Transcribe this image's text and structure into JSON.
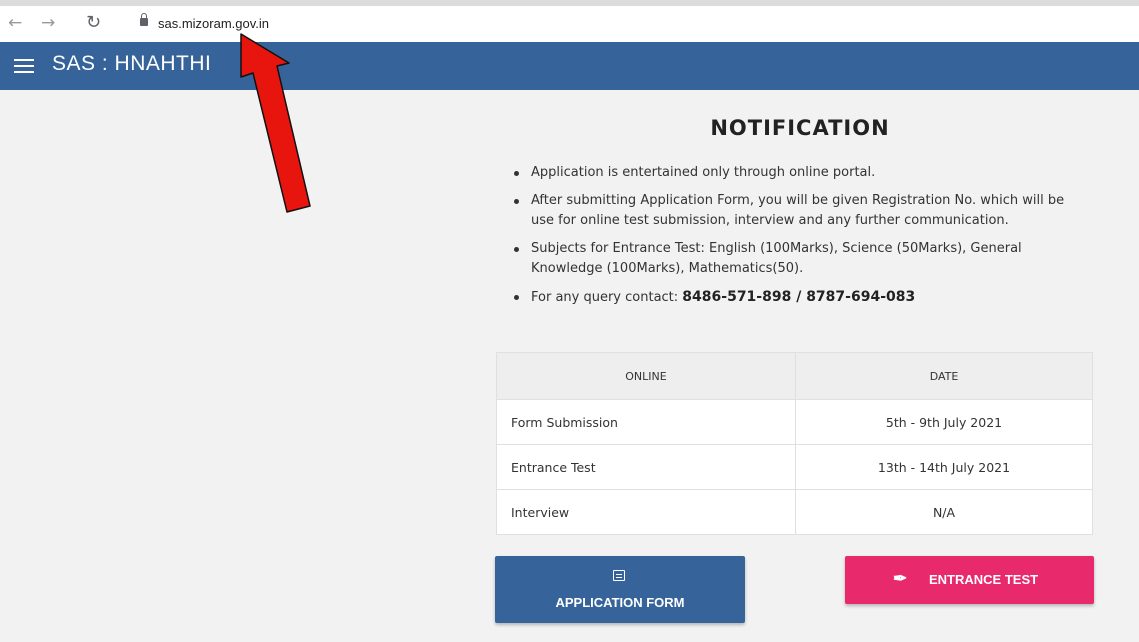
{
  "browser": {
    "back_icon": "←",
    "forward_icon": "→",
    "reload_icon": "↻",
    "url": "sas.mizoram.gov.in"
  },
  "header": {
    "title": "SAS : HNAHTHI",
    "color": "#36649a"
  },
  "notification": {
    "title": "NOTIFICATION",
    "items": [
      "Application is entertained only through online portal.",
      "After submitting Application Form, you will be given Registration No. which will be use for online test submission, interview and any further communication.",
      "Subjects for Entrance Test: English (100Marks), Science (50Marks), General Knowledge (100Marks), Mathematics(50)."
    ],
    "contact_prefix": "For any query contact: ",
    "contact_phones": "8486-571-898 / 8787-694-083"
  },
  "schedule": {
    "headers": [
      "ONLINE",
      "DATE"
    ],
    "rows": [
      {
        "label": "Form Submission",
        "date": "5th - 9th July 2021"
      },
      {
        "label": "Entrance Test",
        "date": "13th - 14th July 2021"
      },
      {
        "label": "Interview",
        "date": "N/A"
      }
    ]
  },
  "buttons": {
    "application_form": "APPLICATION FORM",
    "entrance_test": "ENTRANCE TEST",
    "application_color": "#36649a",
    "entrance_color": "#e8296b"
  },
  "annotation": {
    "arrow_color": "#e8140e"
  }
}
